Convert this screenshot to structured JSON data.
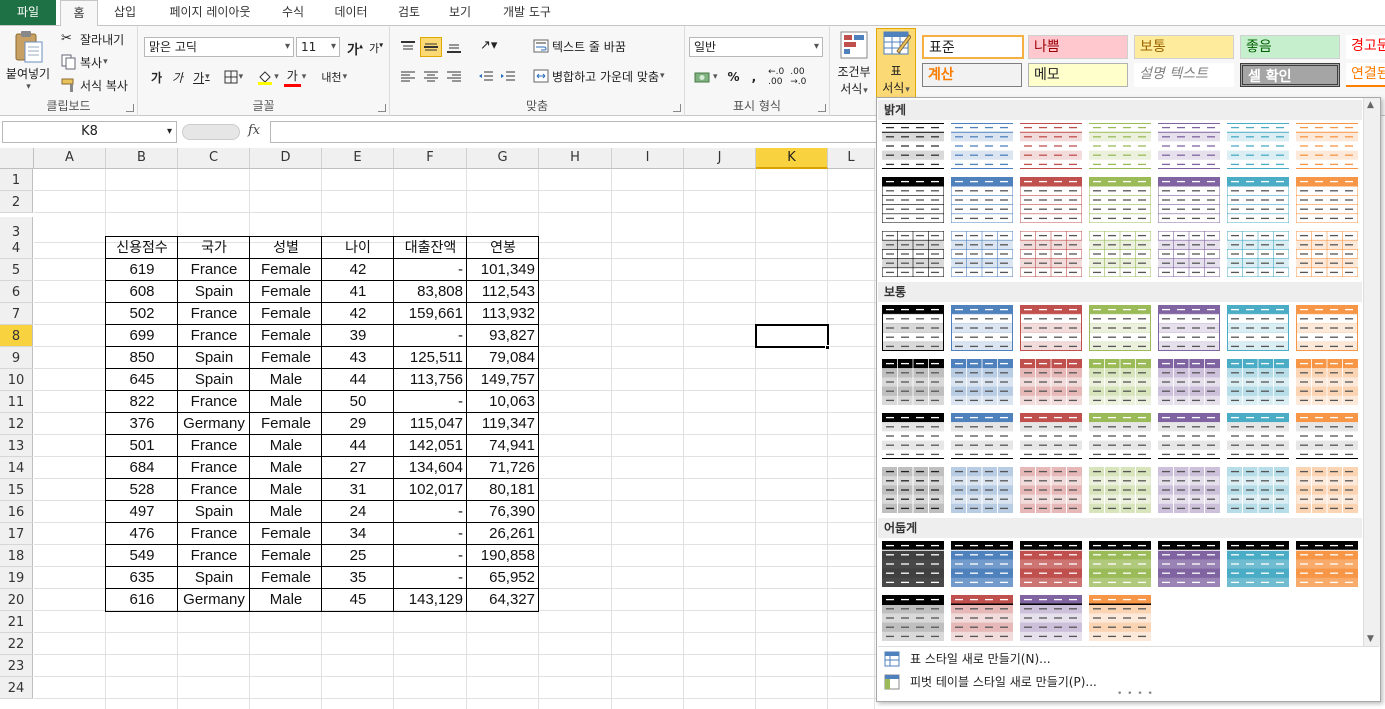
{
  "ribbon_tabs": [
    {
      "label": "파일",
      "name": "tab-file"
    },
    {
      "label": "홈",
      "name": "tab-home"
    },
    {
      "label": "삽입",
      "name": "tab-insert"
    },
    {
      "label": "페이지 레이아웃",
      "name": "tab-page-layout"
    },
    {
      "label": "수식",
      "name": "tab-formulas"
    },
    {
      "label": "데이터",
      "name": "tab-data"
    },
    {
      "label": "검토",
      "name": "tab-review"
    },
    {
      "label": "보기",
      "name": "tab-view"
    },
    {
      "label": "개발 도구",
      "name": "tab-developer"
    }
  ],
  "clipboard": {
    "paste": "붙여넣기",
    "cut": "잘라내기",
    "copy": "복사",
    "format_painter": "서식 복사",
    "label": "클립보드"
  },
  "font": {
    "name": "맑은 고딕",
    "size": "11",
    "grow": "가",
    "shrink": "가",
    "bold": "가",
    "italic": "가",
    "underline": "가",
    "font_color": "가",
    "phonetic": "내천",
    "label": "글꼴"
  },
  "alignment": {
    "wrap_text": "텍스트 줄 바꿈",
    "merge_center": "병합하고 가운데 맞춤",
    "label": "맞춤"
  },
  "number": {
    "format": "일반",
    "percent": "%",
    "comma": ",",
    "label": "표시 형식"
  },
  "styles": {
    "conditional": "조건부",
    "conditional2": "서식",
    "format_table": "표",
    "format_table2": "서식",
    "cells": [
      "표준",
      "나쁨",
      "보통",
      "좋음",
      "경고문",
      "계산",
      "메모",
      "설명 텍스트",
      "셀 확인",
      "연결된"
    ]
  },
  "formula_bar": {
    "name_box": "K8",
    "fx": "fx",
    "formula": ""
  },
  "grid": {
    "columns": [
      "A",
      "B",
      "C",
      "D",
      "E",
      "F",
      "G",
      "H",
      "I",
      "J",
      "K",
      "L"
    ],
    "selected_column": "K",
    "rows": [
      "1",
      "2",
      "3",
      "4",
      "5",
      "6",
      "7",
      "8",
      "9",
      "10",
      "11",
      "12",
      "13",
      "14",
      "15",
      "16",
      "17",
      "18",
      "19",
      "20",
      "21",
      "22",
      "23",
      "24"
    ],
    "selected_row": "8",
    "table_headers": [
      "신용점수",
      "국가",
      "성별",
      "나이",
      "대출잔액",
      "연봉"
    ],
    "table_rows": [
      [
        "619",
        "France",
        "Female",
        "42",
        "-",
        "101,349"
      ],
      [
        "608",
        "Spain",
        "Female",
        "41",
        "83,808",
        "112,543"
      ],
      [
        "502",
        "France",
        "Female",
        "42",
        "159,661",
        "113,932"
      ],
      [
        "699",
        "France",
        "Female",
        "39",
        "-",
        "93,827"
      ],
      [
        "850",
        "Spain",
        "Female",
        "43",
        "125,511",
        "79,084"
      ],
      [
        "645",
        "Spain",
        "Male",
        "44",
        "113,756",
        "149,757"
      ],
      [
        "822",
        "France",
        "Male",
        "50",
        "-",
        "10,063"
      ],
      [
        "376",
        "Germany",
        "Female",
        "29",
        "115,047",
        "119,347"
      ],
      [
        "501",
        "France",
        "Male",
        "44",
        "142,051",
        "74,941"
      ],
      [
        "684",
        "France",
        "Male",
        "27",
        "134,604",
        "71,726"
      ],
      [
        "528",
        "France",
        "Male",
        "31",
        "102,017",
        "80,181"
      ],
      [
        "497",
        "Spain",
        "Male",
        "24",
        "-",
        "76,390"
      ],
      [
        "476",
        "France",
        "Female",
        "34",
        "-",
        "26,261"
      ],
      [
        "549",
        "France",
        "Female",
        "25",
        "-",
        "190,858"
      ],
      [
        "635",
        "Spain",
        "Female",
        "35",
        "-",
        "65,952"
      ],
      [
        "616",
        "Germany",
        "Male",
        "45",
        "143,129",
        "64,327"
      ]
    ]
  },
  "gallery": {
    "sections": [
      "밝게",
      "보통",
      "어둡게"
    ],
    "menu": [
      "표 스타일 새로 만들기(N)...",
      "피벗 테이블 스타일 새로 만들기(P)..."
    ],
    "theme_colors": [
      "#000000",
      "#4f81bd",
      "#c0504d",
      "#9bbb59",
      "#8064a2",
      "#4bacc6",
      "#f79646"
    ]
  }
}
